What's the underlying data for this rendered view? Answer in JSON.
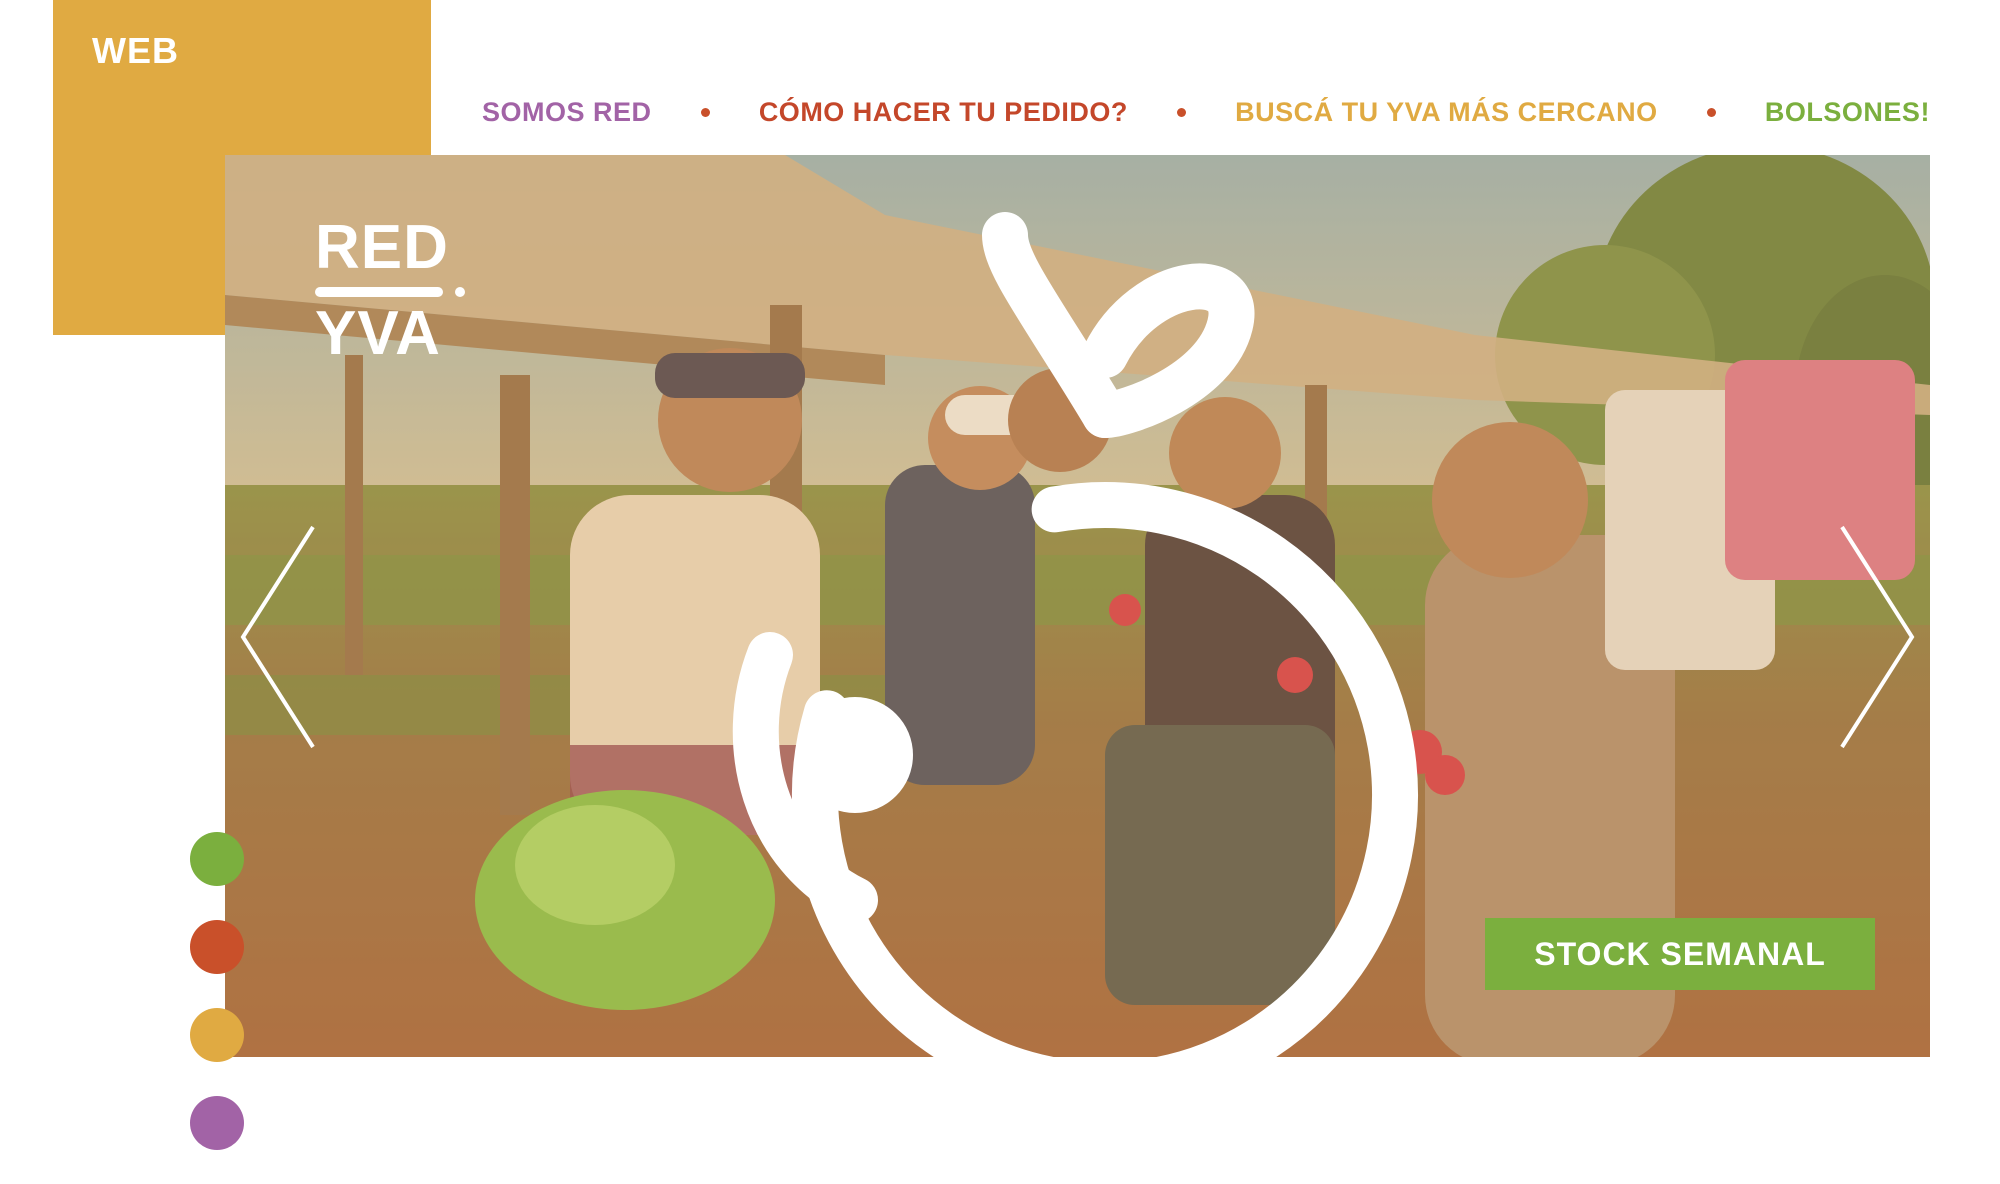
{
  "corner": {
    "label": "WEB"
  },
  "nav": {
    "items": [
      {
        "label": "SOMOS RED",
        "color": "#A263A6"
      },
      {
        "label": "CÓMO HACER TU PEDIDO?",
        "color": "#C4472A"
      },
      {
        "label": "BUSCÁ TU YVA MÁS CERCANO",
        "color": "#E0AA42"
      },
      {
        "label": "BOLSONES!",
        "color": "#7BAF3E"
      }
    ],
    "separator_color": "#C9502A"
  },
  "hero": {
    "logo": {
      "line1": "RED",
      "line2": "YVA"
    },
    "cta": {
      "label": "STOCK SEMANAL"
    }
  },
  "colors": {
    "brand_yellow": "#E0AA42",
    "brand_green": "#7BAF3E",
    "brand_orange": "#C9502A",
    "brand_purple": "#A263A6"
  },
  "carousel": {
    "indicators": [
      "#7BAF3E",
      "#C9502A",
      "#E0AA42",
      "#A263A6"
    ]
  }
}
